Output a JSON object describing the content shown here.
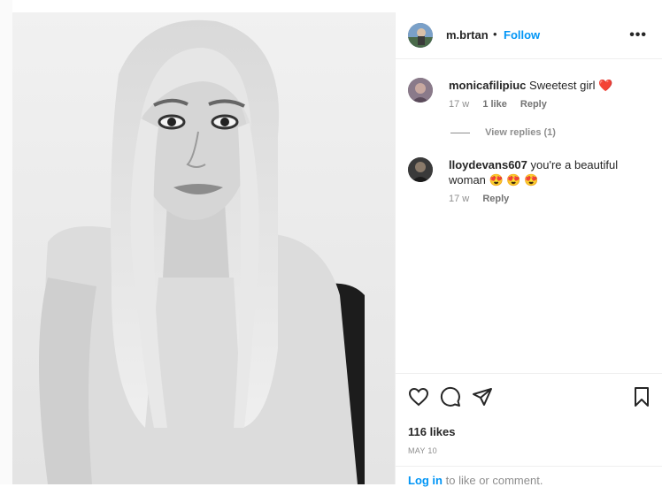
{
  "post": {
    "author": "m.brtan",
    "separator": "•",
    "follow_label": "Follow",
    "more_label": "•••",
    "likes": "116 likes",
    "date": "MAY 10"
  },
  "comments": [
    {
      "username": "monicafilipiuc",
      "text": "Sweetest girl",
      "emoji": "❤️",
      "age": "17 w",
      "likes": "1 like",
      "reply_label": "Reply"
    },
    {
      "username": "lloydevans607",
      "text": "you're a beautiful woman",
      "emoji": "😍 😍 😍",
      "age": "17 w",
      "reply_label": "Reply"
    }
  ],
  "view_replies": "View replies (1)",
  "footer": {
    "login_label": "Log in",
    "login_suffix": "to like or comment."
  },
  "icons": {
    "like": "heart-icon",
    "comment": "comment-icon",
    "share": "paper-plane-icon",
    "save": "bookmark-icon",
    "more": "more-icon"
  },
  "colors": {
    "accent": "#0095f6",
    "heart": "#ed4956",
    "muted": "#8e8e8e"
  }
}
